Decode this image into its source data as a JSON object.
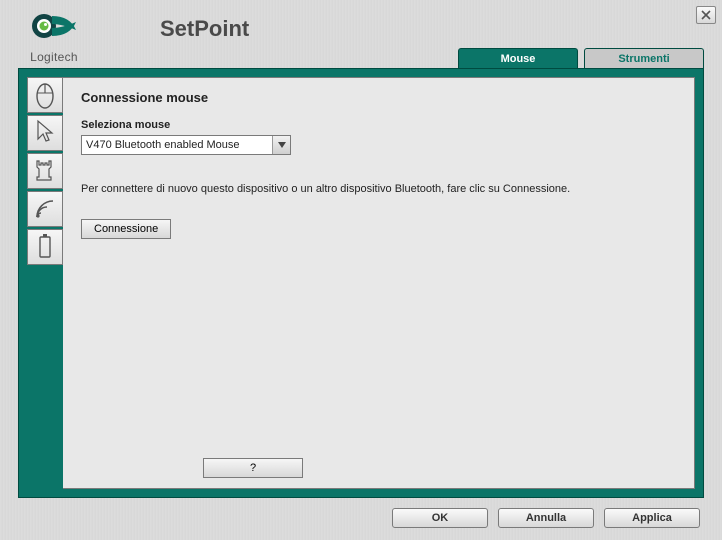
{
  "brand": "Logitech",
  "app_title": "SetPoint",
  "tabs": {
    "mouse": "Mouse",
    "tools": "Strumenti"
  },
  "panel": {
    "title": "Connessione mouse",
    "select_label": "Seleziona mouse",
    "selected_device": "V470 Bluetooth enabled Mouse",
    "instruction": "Per connettere di nuovo questo dispositivo o un altro dispositivo Bluetooth, fare clic su Connessione.",
    "connect_button": "Connessione",
    "help_button": "?"
  },
  "footer": {
    "ok": "OK",
    "cancel": "Annulla",
    "apply": "Applica"
  },
  "side_icons": {
    "mouse": "mouse-icon",
    "cursor": "cursor-icon",
    "chess": "chess-icon",
    "wireless": "wireless-icon",
    "battery": "battery-icon"
  }
}
